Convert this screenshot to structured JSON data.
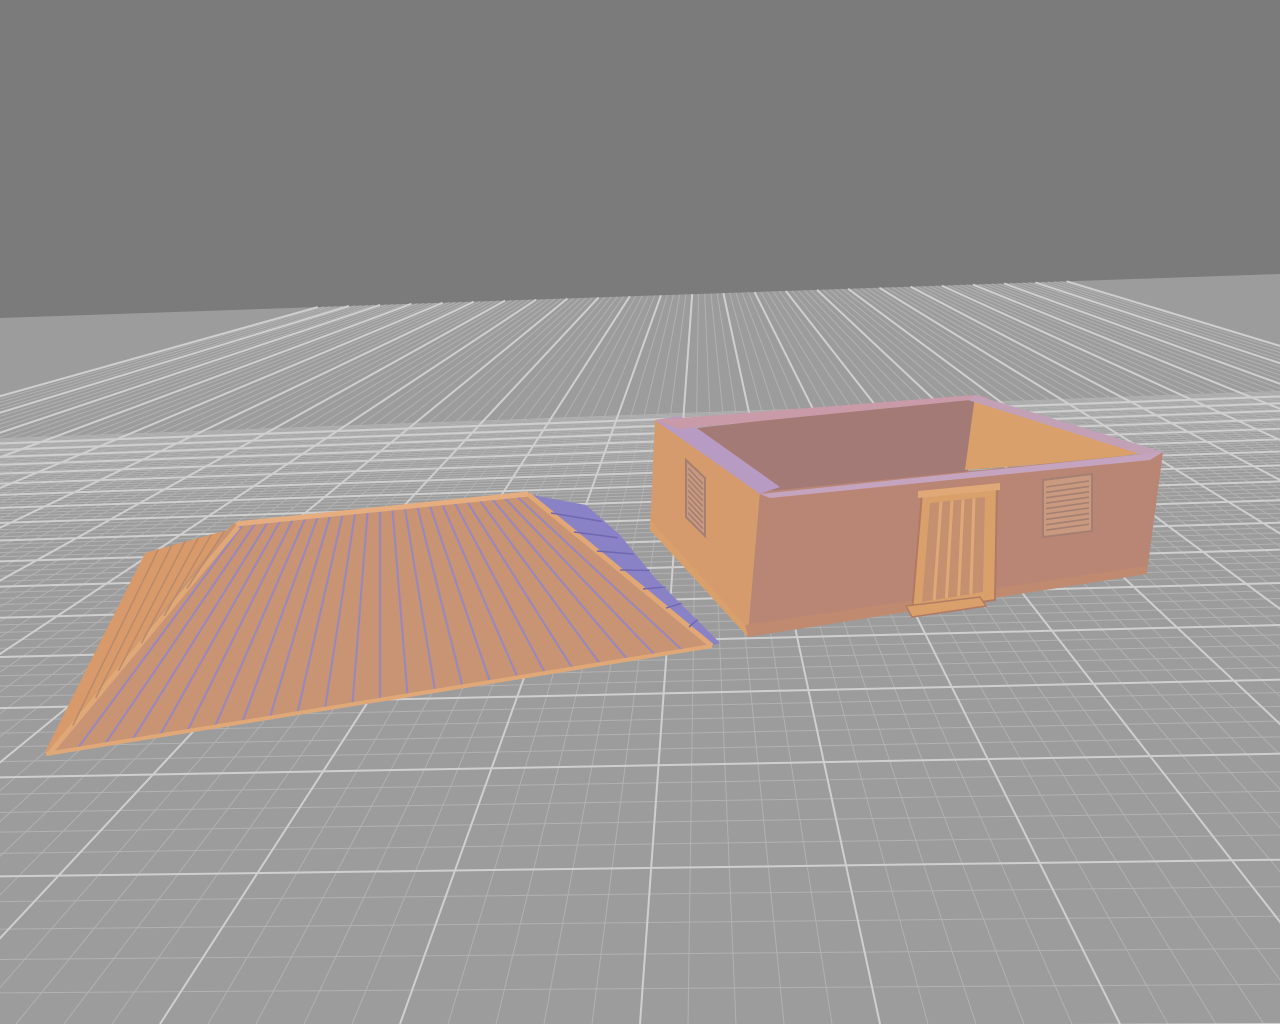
{
  "viewport": {
    "background_color": "#7b7b7b",
    "floor_color": "#9c9c9c",
    "grid_minor_color": "#b1b1b1",
    "grid_major_color": "#cfcfcf"
  },
  "models": [
    {
      "name": "hip-roof",
      "colors": {
        "main_face": "#c99474",
        "left_face": "#d89a6a",
        "right_face": "#8a82c6",
        "seam": "#9c88b8",
        "ridge": "#e0a777"
      }
    },
    {
      "name": "building-walls",
      "colors": {
        "outer_front": "#b98574",
        "outer_side": "#d69b6c",
        "inner_back": "#a37a76",
        "inner_right": "#d9a06c",
        "rim": "#b89bc2",
        "door_frame": "#d9a06c",
        "louver": "#c99a80",
        "base": "#c08a70"
      }
    }
  ]
}
